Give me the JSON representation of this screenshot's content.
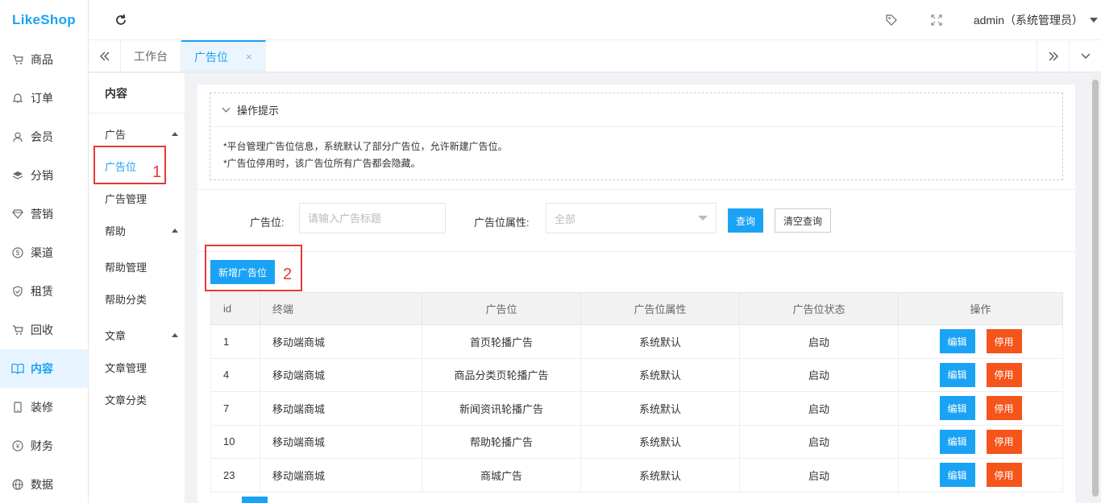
{
  "logo": "LikeShop",
  "main_nav": [
    {
      "label": "商品",
      "icon": "cart-icon"
    },
    {
      "label": "订单",
      "icon": "bell-icon"
    },
    {
      "label": "会员",
      "icon": "user-icon"
    },
    {
      "label": "分销",
      "icon": "layers-icon"
    },
    {
      "label": "营销",
      "icon": "diamond-icon"
    },
    {
      "label": "渠道",
      "icon": "dollar-icon"
    },
    {
      "label": "租赁",
      "icon": "shield-icon"
    },
    {
      "label": "回收",
      "icon": "cart-icon"
    },
    {
      "label": "内容",
      "icon": "book-icon"
    },
    {
      "label": "装修",
      "icon": "tablet-icon"
    },
    {
      "label": "财务",
      "icon": "yen-icon"
    },
    {
      "label": "数据",
      "icon": "globe-icon"
    }
  ],
  "header": {
    "admin_label": "admin（系统管理员）"
  },
  "tabs": [
    {
      "label": "工作台"
    },
    {
      "label": "广告位",
      "close": "×"
    }
  ],
  "sub_nav": {
    "title": "内容",
    "groups": [
      {
        "label": "广告",
        "items": [
          "广告位",
          "广告管理"
        ]
      },
      {
        "label": "帮助",
        "items": [
          "帮助管理",
          "帮助分类"
        ]
      },
      {
        "label": "文章",
        "items": [
          "文章管理",
          "文章分类"
        ]
      }
    ]
  },
  "annotations": {
    "one": "1",
    "two": "2"
  },
  "tips": {
    "title": "操作提示",
    "lines": [
      "*平台管理广告位信息，系统默认了部分广告位，允许新建广告位。",
      "*广告位停用时，该广告位所有广告都会隐藏。"
    ]
  },
  "search": {
    "label_title": "广告位:",
    "placeholder_title": "请输入广告标题",
    "label_attr": "广告位属性:",
    "attr_value": "全部",
    "query_btn": "查询",
    "clear_btn": "清空查询"
  },
  "add_btn": "新增广告位",
  "table": {
    "headers": [
      "id",
      "终端",
      "广告位",
      "广告位属性",
      "广告位状态",
      "操作"
    ],
    "rows": [
      {
        "id": "1",
        "terminal": "移动端商城",
        "name": "首页轮播广告",
        "attr": "系统默认",
        "status": "启动"
      },
      {
        "id": "4",
        "terminal": "移动端商城",
        "name": "商品分类页轮播广告",
        "attr": "系统默认",
        "status": "启动"
      },
      {
        "id": "7",
        "terminal": "移动端商城",
        "name": "新闻资讯轮播广告",
        "attr": "系统默认",
        "status": "启动"
      },
      {
        "id": "10",
        "terminal": "移动端商城",
        "name": "帮助轮播广告",
        "attr": "系统默认",
        "status": "启动"
      },
      {
        "id": "23",
        "terminal": "移动端商城",
        "name": "商城广告",
        "attr": "系统默认",
        "status": "启动"
      }
    ],
    "edit_label": "编辑",
    "stop_label": "停用"
  }
}
